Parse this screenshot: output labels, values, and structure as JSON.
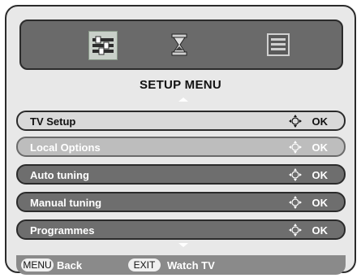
{
  "menu": {
    "title": "SETUP MENU",
    "icons": [
      "settings-sliders-icon",
      "hourglass-icon",
      "screen-icon"
    ],
    "items": [
      {
        "label": "TV Setup",
        "action": "OK"
      },
      {
        "label": "Local Options",
        "action": "OK"
      },
      {
        "label": "Auto tuning",
        "action": "OK"
      },
      {
        "label": "Manual tuning",
        "action": "OK"
      },
      {
        "label": "Programmes",
        "action": "OK"
      }
    ],
    "selected_index": 1
  },
  "footer": {
    "menu_key": "MENU",
    "back_label": "Back",
    "exit_key": "EXIT",
    "watch_label": "Watch TV"
  },
  "colors": {
    "panel_bg": "#e8e8e8",
    "icon_bar_bg": "#6a6a6a",
    "row_bg": "#6e6e6e",
    "row_selected_bg": "#bdbdbd",
    "footer_bg": "#8a8a8a"
  }
}
